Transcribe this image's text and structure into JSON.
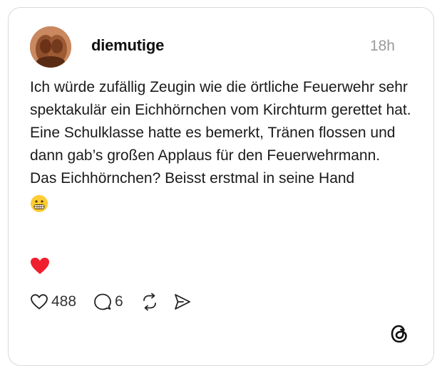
{
  "post": {
    "username": "diemutige",
    "time": "18h",
    "text_main": "Ich würde zufällig Zeugin wie die örtliche Feuerwehr sehr spektakulär ein Eichhörnchen vom Kirchturm gerettet hat. Eine Schulklasse hatte es bemerkt, Tränen flossen und dann gab’s großen Applaus für den Feuerwehrmann.",
    "text_second": "Das Eichhörnchen? Beisst erstmal in seine Hand",
    "emoji": "grimacing-face-emoji",
    "reaction": "red-heart-emoji"
  },
  "actions": {
    "likes": "488",
    "replies": "6",
    "repost_icon": "repost-icon",
    "share_icon": "send-icon"
  },
  "brand": {
    "logo": "threads-logo-icon",
    "accent": "#ef1f2e"
  }
}
